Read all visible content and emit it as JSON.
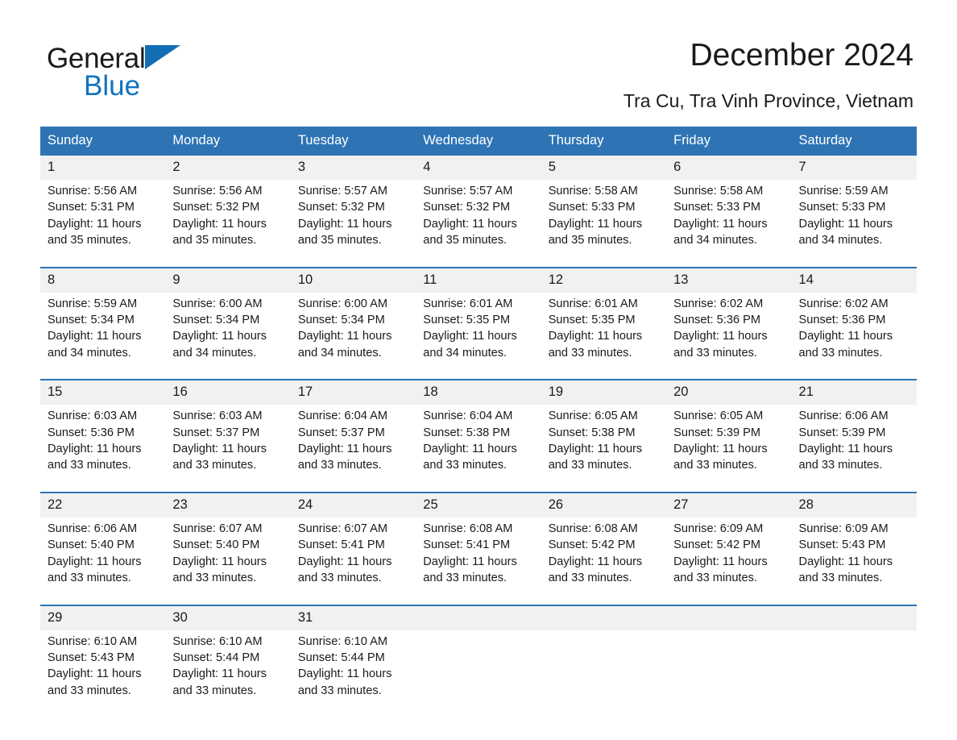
{
  "brand": {
    "name_part1": "General",
    "name_part2": "Blue",
    "triangle_color": "#136db4",
    "blue_text_color": "#1173be"
  },
  "header": {
    "title": "December 2024",
    "subtitle": "Tra Cu, Tra Vinh Province, Vietnam"
  },
  "colors": {
    "header_bar": "#2e74b5",
    "daynum_band": "#f1f1f1",
    "row_separator": "#2e74b5",
    "text": "#1a1a1a",
    "header_text": "#ffffff"
  },
  "calendar": {
    "weekday_headers": [
      "Sunday",
      "Monday",
      "Tuesday",
      "Wednesday",
      "Thursday",
      "Friday",
      "Saturday"
    ],
    "weeks": [
      [
        {
          "day": "1",
          "sunrise": "Sunrise: 5:56 AM",
          "sunset": "Sunset: 5:31 PM",
          "daylight_line1": "Daylight: 11 hours",
          "daylight_line2": "and 35 minutes."
        },
        {
          "day": "2",
          "sunrise": "Sunrise: 5:56 AM",
          "sunset": "Sunset: 5:32 PM",
          "daylight_line1": "Daylight: 11 hours",
          "daylight_line2": "and 35 minutes."
        },
        {
          "day": "3",
          "sunrise": "Sunrise: 5:57 AM",
          "sunset": "Sunset: 5:32 PM",
          "daylight_line1": "Daylight: 11 hours",
          "daylight_line2": "and 35 minutes."
        },
        {
          "day": "4",
          "sunrise": "Sunrise: 5:57 AM",
          "sunset": "Sunset: 5:32 PM",
          "daylight_line1": "Daylight: 11 hours",
          "daylight_line2": "and 35 minutes."
        },
        {
          "day": "5",
          "sunrise": "Sunrise: 5:58 AM",
          "sunset": "Sunset: 5:33 PM",
          "daylight_line1": "Daylight: 11 hours",
          "daylight_line2": "and 35 minutes."
        },
        {
          "day": "6",
          "sunrise": "Sunrise: 5:58 AM",
          "sunset": "Sunset: 5:33 PM",
          "daylight_line1": "Daylight: 11 hours",
          "daylight_line2": "and 34 minutes."
        },
        {
          "day": "7",
          "sunrise": "Sunrise: 5:59 AM",
          "sunset": "Sunset: 5:33 PM",
          "daylight_line1": "Daylight: 11 hours",
          "daylight_line2": "and 34 minutes."
        }
      ],
      [
        {
          "day": "8",
          "sunrise": "Sunrise: 5:59 AM",
          "sunset": "Sunset: 5:34 PM",
          "daylight_line1": "Daylight: 11 hours",
          "daylight_line2": "and 34 minutes."
        },
        {
          "day": "9",
          "sunrise": "Sunrise: 6:00 AM",
          "sunset": "Sunset: 5:34 PM",
          "daylight_line1": "Daylight: 11 hours",
          "daylight_line2": "and 34 minutes."
        },
        {
          "day": "10",
          "sunrise": "Sunrise: 6:00 AM",
          "sunset": "Sunset: 5:34 PM",
          "daylight_line1": "Daylight: 11 hours",
          "daylight_line2": "and 34 minutes."
        },
        {
          "day": "11",
          "sunrise": "Sunrise: 6:01 AM",
          "sunset": "Sunset: 5:35 PM",
          "daylight_line1": "Daylight: 11 hours",
          "daylight_line2": "and 34 minutes."
        },
        {
          "day": "12",
          "sunrise": "Sunrise: 6:01 AM",
          "sunset": "Sunset: 5:35 PM",
          "daylight_line1": "Daylight: 11 hours",
          "daylight_line2": "and 33 minutes."
        },
        {
          "day": "13",
          "sunrise": "Sunrise: 6:02 AM",
          "sunset": "Sunset: 5:36 PM",
          "daylight_line1": "Daylight: 11 hours",
          "daylight_line2": "and 33 minutes."
        },
        {
          "day": "14",
          "sunrise": "Sunrise: 6:02 AM",
          "sunset": "Sunset: 5:36 PM",
          "daylight_line1": "Daylight: 11 hours",
          "daylight_line2": "and 33 minutes."
        }
      ],
      [
        {
          "day": "15",
          "sunrise": "Sunrise: 6:03 AM",
          "sunset": "Sunset: 5:36 PM",
          "daylight_line1": "Daylight: 11 hours",
          "daylight_line2": "and 33 minutes."
        },
        {
          "day": "16",
          "sunrise": "Sunrise: 6:03 AM",
          "sunset": "Sunset: 5:37 PM",
          "daylight_line1": "Daylight: 11 hours",
          "daylight_line2": "and 33 minutes."
        },
        {
          "day": "17",
          "sunrise": "Sunrise: 6:04 AM",
          "sunset": "Sunset: 5:37 PM",
          "daylight_line1": "Daylight: 11 hours",
          "daylight_line2": "and 33 minutes."
        },
        {
          "day": "18",
          "sunrise": "Sunrise: 6:04 AM",
          "sunset": "Sunset: 5:38 PM",
          "daylight_line1": "Daylight: 11 hours",
          "daylight_line2": "and 33 minutes."
        },
        {
          "day": "19",
          "sunrise": "Sunrise: 6:05 AM",
          "sunset": "Sunset: 5:38 PM",
          "daylight_line1": "Daylight: 11 hours",
          "daylight_line2": "and 33 minutes."
        },
        {
          "day": "20",
          "sunrise": "Sunrise: 6:05 AM",
          "sunset": "Sunset: 5:39 PM",
          "daylight_line1": "Daylight: 11 hours",
          "daylight_line2": "and 33 minutes."
        },
        {
          "day": "21",
          "sunrise": "Sunrise: 6:06 AM",
          "sunset": "Sunset: 5:39 PM",
          "daylight_line1": "Daylight: 11 hours",
          "daylight_line2": "and 33 minutes."
        }
      ],
      [
        {
          "day": "22",
          "sunrise": "Sunrise: 6:06 AM",
          "sunset": "Sunset: 5:40 PM",
          "daylight_line1": "Daylight: 11 hours",
          "daylight_line2": "and 33 minutes."
        },
        {
          "day": "23",
          "sunrise": "Sunrise: 6:07 AM",
          "sunset": "Sunset: 5:40 PM",
          "daylight_line1": "Daylight: 11 hours",
          "daylight_line2": "and 33 minutes."
        },
        {
          "day": "24",
          "sunrise": "Sunrise: 6:07 AM",
          "sunset": "Sunset: 5:41 PM",
          "daylight_line1": "Daylight: 11 hours",
          "daylight_line2": "and 33 minutes."
        },
        {
          "day": "25",
          "sunrise": "Sunrise: 6:08 AM",
          "sunset": "Sunset: 5:41 PM",
          "daylight_line1": "Daylight: 11 hours",
          "daylight_line2": "and 33 minutes."
        },
        {
          "day": "26",
          "sunrise": "Sunrise: 6:08 AM",
          "sunset": "Sunset: 5:42 PM",
          "daylight_line1": "Daylight: 11 hours",
          "daylight_line2": "and 33 minutes."
        },
        {
          "day": "27",
          "sunrise": "Sunrise: 6:09 AM",
          "sunset": "Sunset: 5:42 PM",
          "daylight_line1": "Daylight: 11 hours",
          "daylight_line2": "and 33 minutes."
        },
        {
          "day": "28",
          "sunrise": "Sunrise: 6:09 AM",
          "sunset": "Sunset: 5:43 PM",
          "daylight_line1": "Daylight: 11 hours",
          "daylight_line2": "and 33 minutes."
        }
      ],
      [
        {
          "day": "29",
          "sunrise": "Sunrise: 6:10 AM",
          "sunset": "Sunset: 5:43 PM",
          "daylight_line1": "Daylight: 11 hours",
          "daylight_line2": "and 33 minutes."
        },
        {
          "day": "30",
          "sunrise": "Sunrise: 6:10 AM",
          "sunset": "Sunset: 5:44 PM",
          "daylight_line1": "Daylight: 11 hours",
          "daylight_line2": "and 33 minutes."
        },
        {
          "day": "31",
          "sunrise": "Sunrise: 6:10 AM",
          "sunset": "Sunset: 5:44 PM",
          "daylight_line1": "Daylight: 11 hours",
          "daylight_line2": "and 33 minutes."
        },
        {
          "day": "",
          "sunrise": "",
          "sunset": "",
          "daylight_line1": "",
          "daylight_line2": ""
        },
        {
          "day": "",
          "sunrise": "",
          "sunset": "",
          "daylight_line1": "",
          "daylight_line2": ""
        },
        {
          "day": "",
          "sunrise": "",
          "sunset": "",
          "daylight_line1": "",
          "daylight_line2": ""
        },
        {
          "day": "",
          "sunrise": "",
          "sunset": "",
          "daylight_line1": "",
          "daylight_line2": ""
        }
      ]
    ]
  }
}
